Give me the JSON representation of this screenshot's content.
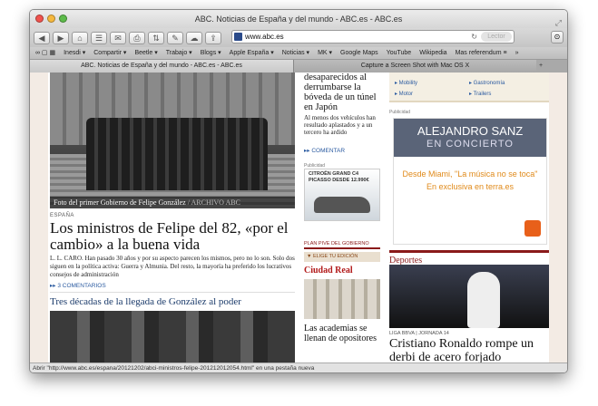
{
  "window": {
    "title": "ABC. Noticias de España y del mundo - ABC.es - ABC.es"
  },
  "toolbar": {
    "url": "www.abc.es",
    "reader_label": "Lector"
  },
  "bookmarks": [
    "Inesdi ▾",
    "Compartir ▾",
    "Beetle ▾",
    "Trabajo ▾",
    "Blogs ▾",
    "Apple España ▾",
    "Noticias ▾",
    "MK ▾",
    "Google Maps",
    "YouTube",
    "Wikipedia",
    "Mas referendum ≡",
    "»"
  ],
  "tabs": [
    {
      "label": "ABC. Noticias de España y del mundo - ABC.es - ABC.es"
    },
    {
      "label": "Capture a Screen Shot with Mac OS X"
    }
  ],
  "main": {
    "photo_caption": "Foto del primer Gobierno de Felipe González",
    "photo_source": "/ ARCHIVO ABC",
    "kicker": "ESPAÑA",
    "headline": "Los ministros de Felipe del 82, «por el cambio» a la buena vida",
    "byline": "L. L. CARO.",
    "lede": "Han pasado 30 años y por su aspecto parecen los mismos, pero no lo son. Solo dos siguen en la política activa: Guerra y Almunia. Del resto, la mayoría ha preferido los lucrativos consejos de administración",
    "comments": "▸▸ 3 COMENTARIOS",
    "subhead": "Tres décadas de la llegada de González al poder"
  },
  "middle": {
    "title": "desaparecidos al derrumbarse la bóveda de un túnel en Japón",
    "text": "Al menos dos vehículos han resultado aplastados y a un tercero ha ardido",
    "comment": "▸▸ COMENTAR",
    "ad_label": "Publicidad",
    "car_ad": "CITROËN GRAND C4 PICASSO DESDE 12.990€",
    "plan": "PLAN PIVE DEL GOBIERNO",
    "elige": "▼ ELIGE TU EDICIÓN",
    "city": "Ciudad Real",
    "title2": "Las academias se llenan de opositores"
  },
  "right": {
    "categories": [
      "▸ Mobility",
      "▸ Gastronomía",
      "▸ Motor",
      "▸ Trailers"
    ],
    "ad_label": "Publicidad",
    "ad_title": "ALEJANDRO SANZ",
    "ad_sub": "EN CONCIERTO",
    "ad_line1": "Desde Miami, \"La música no se toca\"",
    "ad_line2": "En exclusiva en terra.es",
    "section": "Deportes",
    "sport_kicker": "LIGA BBVA | JORNADA 14",
    "sport_title": "Cristiano Ronaldo rompe un derbi de acero forjado"
  },
  "status": "Abrir \"http://www.abc.es/espana/20121202/abci-ministros-felipe-201212012054.html\" en una pestaña nueva"
}
